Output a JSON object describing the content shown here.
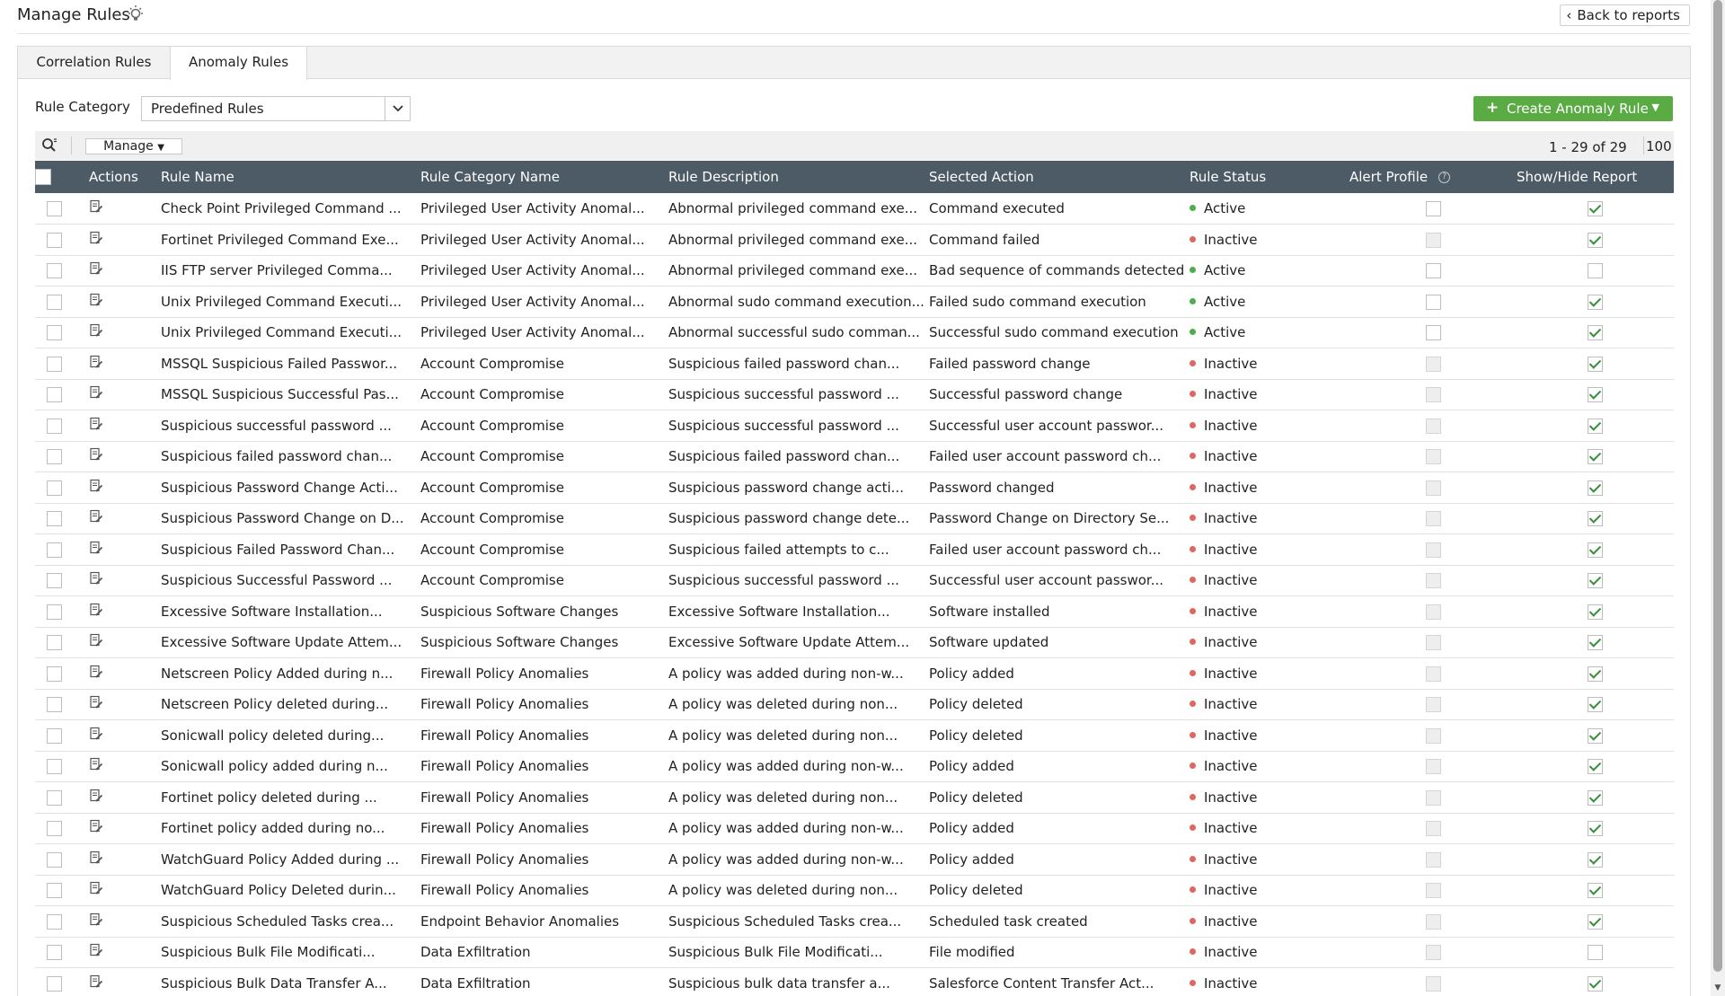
{
  "header": {
    "title": "Manage Rules",
    "back_label": "Back to reports"
  },
  "tabs": [
    {
      "label": "Correlation Rules"
    },
    {
      "label": "Anomaly Rules"
    }
  ],
  "filter": {
    "label": "Rule Category",
    "selected": "Predefined Rules"
  },
  "create_button": {
    "label": "Create Anomaly Rule"
  },
  "toolbar": {
    "manage_label": "Manage",
    "pager": "1 - 29 of 29",
    "per_page": "100"
  },
  "columns": [
    "Actions",
    "Rule Name",
    "Rule Category Name",
    "Rule Description",
    "Selected Action",
    "Rule Status",
    "Alert Profile",
    "Show/Hide Report"
  ],
  "colors": {
    "accent": "#5bab45",
    "header_bg": "#4d5b66",
    "active": "#4cae4c",
    "inactive": "#e0665f"
  },
  "rows": [
    {
      "name": "Check Point Privileged Command ...",
      "category": "Privileged User Activity Anomal...",
      "description": "Abnormal privileged command exe...",
      "action": "Command executed",
      "status": "Active",
      "alert": "empty",
      "report": true
    },
    {
      "name": "Fortinet Privileged Command Exe...",
      "category": "Privileged User Activity Anomal...",
      "description": "Abnormal privileged command exe...",
      "action": "Command failed",
      "status": "Inactive",
      "alert": "disabled",
      "report": true
    },
    {
      "name": "IIS FTP server Privileged Comma...",
      "category": "Privileged User Activity Anomal...",
      "description": "Abnormal privileged command exe...",
      "action": "Bad sequence of commands detected",
      "status": "Active",
      "alert": "empty",
      "report": false
    },
    {
      "name": "Unix Privileged Command Executi...",
      "category": "Privileged User Activity Anomal...",
      "description": "Abnormal sudo command execution...",
      "action": "Failed sudo command execution",
      "status": "Active",
      "alert": "empty",
      "report": true
    },
    {
      "name": "Unix Privileged Command Executi...",
      "category": "Privileged User Activity Anomal...",
      "description": "Abnormal successful sudo comman...",
      "action": "Successful sudo command execution",
      "status": "Active",
      "alert": "empty",
      "report": true
    },
    {
      "name": "MSSQL Suspicious Failed Passwor...",
      "category": "Account Compromise",
      "description": "Suspicious failed password chan...",
      "action": "Failed password change",
      "status": "Inactive",
      "alert": "disabled",
      "report": true
    },
    {
      "name": "MSSQL Suspicious Successful Pas...",
      "category": "Account Compromise",
      "description": "Suspicious successful password ...",
      "action": "Successful password change",
      "status": "Inactive",
      "alert": "disabled",
      "report": true
    },
    {
      "name": "Suspicious successful password ...",
      "category": "Account Compromise",
      "description": "Suspicious successful password ...",
      "action": "Successful user account passwor...",
      "status": "Inactive",
      "alert": "disabled",
      "report": true
    },
    {
      "name": "Suspicious failed password chan...",
      "category": "Account Compromise",
      "description": "Suspicious failed password chan...",
      "action": "Failed user account password ch...",
      "status": "Inactive",
      "alert": "disabled",
      "report": true
    },
    {
      "name": "Suspicious Password Change Acti...",
      "category": "Account Compromise",
      "description": "Suspicious password change acti...",
      "action": "Password changed",
      "status": "Inactive",
      "alert": "disabled",
      "report": true
    },
    {
      "name": "Suspicious Password Change on D...",
      "category": "Account Compromise",
      "description": "Suspicious password change dete...",
      "action": "Password Change on Directory Se...",
      "status": "Inactive",
      "alert": "disabled",
      "report": true
    },
    {
      "name": "Suspicious Failed Password Chan...",
      "category": "Account Compromise",
      "description": "Suspicious failed attempts to c...",
      "action": "Failed user account password ch...",
      "status": "Inactive",
      "alert": "disabled",
      "report": true
    },
    {
      "name": "Suspicious Successful Password ...",
      "category": "Account Compromise",
      "description": "Suspicious successful password ...",
      "action": "Successful user account passwor...",
      "status": "Inactive",
      "alert": "disabled",
      "report": true
    },
    {
      "name": "Excessive Software Installation...",
      "category": "Suspicious Software Changes",
      "description": "Excessive Software Installation...",
      "action": "Software installed",
      "status": "Inactive",
      "alert": "disabled",
      "report": true
    },
    {
      "name": "Excessive Software Update Attem...",
      "category": "Suspicious Software Changes",
      "description": "Excessive Software Update Attem...",
      "action": "Software updated",
      "status": "Inactive",
      "alert": "disabled",
      "report": true
    },
    {
      "name": "Netscreen Policy Added during n...",
      "category": "Firewall Policy Anomalies",
      "description": "A policy was added during non-w...",
      "action": "Policy added",
      "status": "Inactive",
      "alert": "disabled",
      "report": true
    },
    {
      "name": "Netscreen Policy deleted during...",
      "category": "Firewall Policy Anomalies",
      "description": "A policy was deleted during non...",
      "action": "Policy deleted",
      "status": "Inactive",
      "alert": "disabled",
      "report": true
    },
    {
      "name": "Sonicwall policy deleted during...",
      "category": "Firewall Policy Anomalies",
      "description": "A policy was deleted during non...",
      "action": "Policy deleted",
      "status": "Inactive",
      "alert": "disabled",
      "report": true
    },
    {
      "name": "Sonicwall policy added during n...",
      "category": "Firewall Policy Anomalies",
      "description": "A policy was added during non-w...",
      "action": "Policy added",
      "status": "Inactive",
      "alert": "disabled",
      "report": true
    },
    {
      "name": "Fortinet policy deleted during ...",
      "category": "Firewall Policy Anomalies",
      "description": "A policy was deleted during non...",
      "action": "Policy deleted",
      "status": "Inactive",
      "alert": "disabled",
      "report": true
    },
    {
      "name": "Fortinet policy added during no...",
      "category": "Firewall Policy Anomalies",
      "description": "A policy was added during non-w...",
      "action": "Policy added",
      "status": "Inactive",
      "alert": "disabled",
      "report": true
    },
    {
      "name": "WatchGuard Policy Added during ...",
      "category": "Firewall Policy Anomalies",
      "description": "A policy was added during non-w...",
      "action": "Policy added",
      "status": "Inactive",
      "alert": "disabled",
      "report": true
    },
    {
      "name": "WatchGuard Policy Deleted durin...",
      "category": "Firewall Policy Anomalies",
      "description": "A policy was deleted during non...",
      "action": "Policy deleted",
      "status": "Inactive",
      "alert": "disabled",
      "report": true
    },
    {
      "name": "Suspicious Scheduled Tasks crea...",
      "category": "Endpoint Behavior Anomalies",
      "description": "Suspicious Scheduled Tasks crea...",
      "action": "Scheduled task created",
      "status": "Inactive",
      "alert": "disabled",
      "report": true
    },
    {
      "name": "Suspicious Bulk File Modificati...",
      "category": "Data Exfiltration",
      "description": "Suspicious Bulk File Modificati...",
      "action": "File modified",
      "status": "Inactive",
      "alert": "disabled",
      "report": false
    },
    {
      "name": "Suspicious Bulk Data Transfer A...",
      "category": "Data Exfiltration",
      "description": "Suspicious bulk data transfer a...",
      "action": "Salesforce Content Transfer Act...",
      "status": "Inactive",
      "alert": "disabled",
      "report": true
    }
  ]
}
